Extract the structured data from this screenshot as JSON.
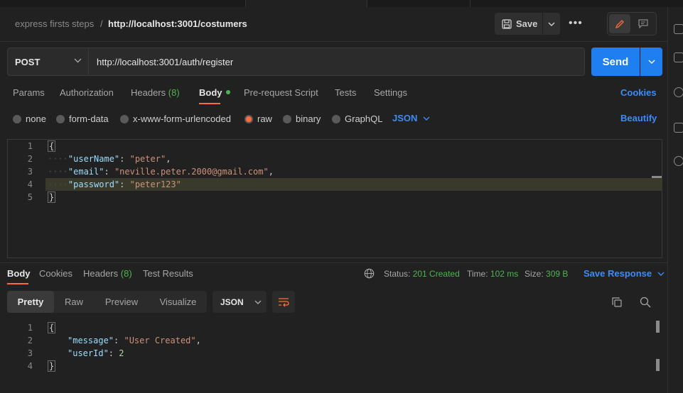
{
  "header": {
    "breadcrumb_parent": "express firsts steps",
    "breadcrumb_sep": "/",
    "breadcrumb_current": "http://localhost:3001/costumers",
    "save_label": "Save",
    "more_label": "•••"
  },
  "request": {
    "method": "POST",
    "url": "http://localhost:3001/auth/register",
    "send_label": "Send",
    "tabs": {
      "params": "Params",
      "authorization": "Authorization",
      "headers": "Headers",
      "headers_count": "(8)",
      "body": "Body",
      "prerequest": "Pre-request Script",
      "tests": "Tests",
      "settings": "Settings"
    },
    "cookies_label": "Cookies",
    "body_types": {
      "none": "none",
      "form_data": "form-data",
      "urlencoded": "x-www-form-urlencoded",
      "raw": "raw",
      "binary": "binary",
      "graphql": "GraphQL"
    },
    "raw_format": "JSON",
    "beautify_label": "Beautify",
    "line_numbers": [
      "1",
      "2",
      "3",
      "4",
      "5"
    ],
    "body_lines": {
      "open": "{",
      "close": "}",
      "indent": "····",
      "k1": "\"userName\"",
      "v1": "\"peter\"",
      "k2": "\"email\"",
      "v2": "\"neville.peter.2000@gmail.com\"",
      "k3": "\"password\"",
      "v3": "\"peter123\""
    }
  },
  "response": {
    "tabs": {
      "body": "Body",
      "cookies": "Cookies",
      "headers": "Headers",
      "headers_count": "(8)",
      "test_results": "Test Results"
    },
    "status_label": "Status:",
    "status_value": "201 Created",
    "time_label": "Time:",
    "time_value": "102 ms",
    "size_label": "Size:",
    "size_value": "309 B",
    "save_response_label": "Save Response",
    "views": {
      "pretty": "Pretty",
      "raw": "Raw",
      "preview": "Preview",
      "visualize": "Visualize"
    },
    "format": "JSON",
    "line_numbers": [
      "1",
      "2",
      "3",
      "4"
    ],
    "body_lines": {
      "open": "{",
      "close": "}",
      "k1": "\"message\"",
      "v1": "\"User Created\"",
      "k2": "\"userId\"",
      "v2": "2"
    }
  },
  "colors": {
    "accent": "#ff6c37",
    "send": "#1f7ff0",
    "success": "#4fb34f",
    "link": "#3d8cf5"
  }
}
